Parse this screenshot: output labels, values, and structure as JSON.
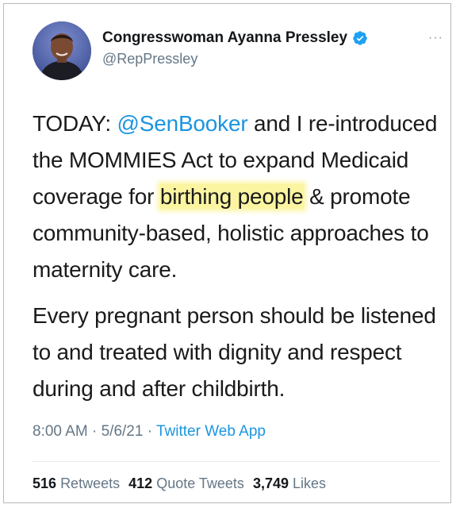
{
  "author": {
    "display_name": "Congresswoman Ayanna Pressley",
    "handle": "@RepPressley",
    "verified_icon": "verified-badge-icon",
    "more_icon": "more-options-icon",
    "more_glyph": "···"
  },
  "tweet": {
    "p1_a": "TODAY: ",
    "p1_mention": "@SenBooker",
    "p1_b": " and I re-introduced the MOMMIES Act to expand Medicaid coverage for ",
    "p1_highlight": "birthing people",
    "p1_c": " & promote community-based, holistic approaches to maternity care.",
    "p2": "Every pregnant person should be listened to and treated with dignity and respect during and after childbirth."
  },
  "meta": {
    "time": "8:00 AM",
    "sep1": " · ",
    "date": "5/6/21",
    "sep2": " · ",
    "source": "Twitter Web App"
  },
  "stats": {
    "retweets_count": "516",
    "retweets_label": "Retweets",
    "quotes_count": "412",
    "quotes_label": "Quote Tweets",
    "likes_count": "3,749",
    "likes_label": "Likes"
  },
  "colors": {
    "link": "#1b95e0",
    "muted": "#657786",
    "highlight": "#fbf5a1"
  }
}
